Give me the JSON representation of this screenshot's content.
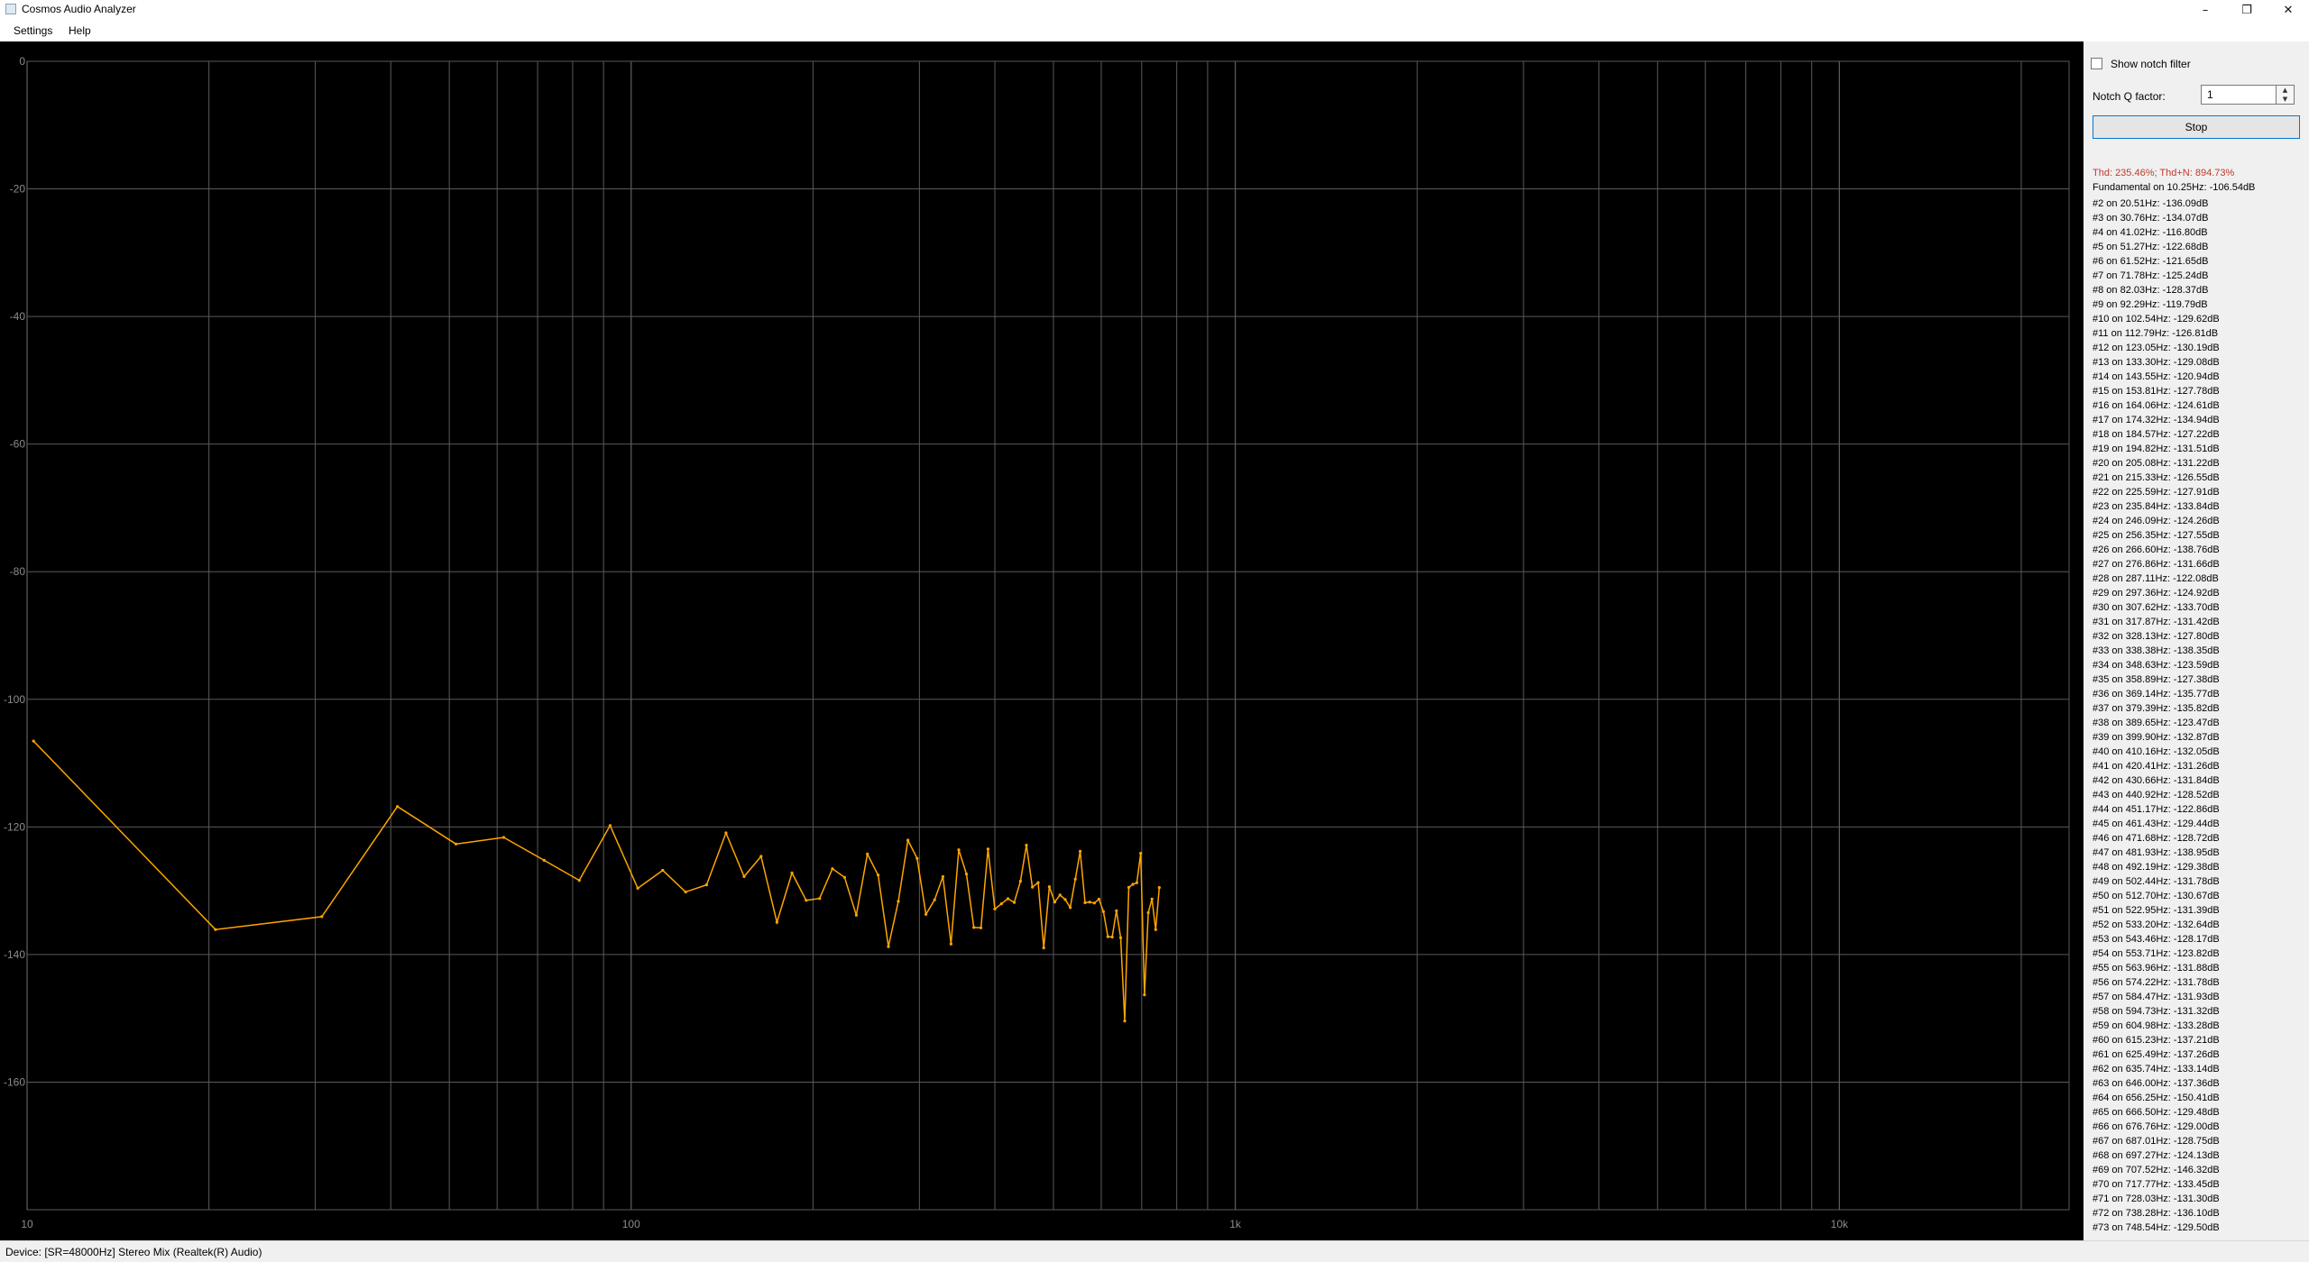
{
  "window": {
    "title": "Cosmos Audio Analyzer",
    "controls": {
      "minimize": "–",
      "maximize": "❐",
      "close": "✕"
    }
  },
  "menu": {
    "items": [
      "Settings",
      "Help"
    ]
  },
  "chart_data": {
    "type": "line",
    "x_scale": "log",
    "xlim": [
      10,
      24000
    ],
    "ylim": [
      -180,
      0
    ],
    "x_tick_labels": [
      {
        "value": 10,
        "label": "10"
      },
      {
        "value": 100,
        "label": "100"
      },
      {
        "value": 1000,
        "label": "1k"
      },
      {
        "value": 10000,
        "label": "10k"
      }
    ],
    "y_ticks": [
      0,
      -20,
      -40,
      -60,
      -80,
      -100,
      -120,
      -140,
      -160
    ],
    "grid": true,
    "line_color": "#ffa500",
    "background": "#000000",
    "grid_color": "#5a5a5a",
    "axis_label_color": "#8c8c8c",
    "x": [
      10.25,
      20.51,
      30.76,
      41.02,
      51.27,
      61.52,
      71.78,
      82.03,
      92.29,
      102.54,
      112.79,
      123.05,
      133.3,
      143.55,
      153.81,
      164.06,
      174.32,
      184.57,
      194.82,
      205.08,
      215.33,
      225.59,
      235.84,
      246.09,
      256.35,
      266.6,
      276.86,
      287.11,
      297.36,
      307.62,
      317.87,
      328.13,
      338.38,
      348.63,
      358.89,
      369.14,
      379.39,
      389.65,
      399.9,
      410.16,
      420.41,
      430.66,
      440.92,
      451.17,
      461.43,
      471.68,
      481.93,
      492.19,
      502.44,
      512.7,
      522.95,
      533.2,
      543.46,
      553.71,
      563.96,
      574.22,
      584.47,
      594.73,
      604.98,
      615.23,
      625.49,
      635.74,
      646.0,
      656.25,
      666.5,
      676.76,
      687.01,
      697.27,
      707.52,
      717.77,
      728.03,
      738.28,
      748.54
    ],
    "y": [
      -106.54,
      -136.09,
      -134.07,
      -116.8,
      -122.68,
      -121.65,
      -125.24,
      -128.37,
      -119.79,
      -129.62,
      -126.81,
      -130.19,
      -129.08,
      -120.94,
      -127.78,
      -124.61,
      -134.94,
      -127.22,
      -131.51,
      -131.22,
      -126.55,
      -127.91,
      -133.84,
      -124.26,
      -127.55,
      -138.76,
      -131.66,
      -122.08,
      -124.92,
      -133.7,
      -131.42,
      -127.8,
      -138.35,
      -123.59,
      -127.38,
      -135.77,
      -135.82,
      -123.47,
      -132.87,
      -132.05,
      -131.26,
      -131.84,
      -128.52,
      -122.86,
      -129.44,
      -128.72,
      -138.95,
      -129.38,
      -131.78,
      -130.67,
      -131.39,
      -132.64,
      -128.17,
      -123.82,
      -131.88,
      -131.78,
      -131.93,
      -131.32,
      -133.28,
      -137.21,
      -137.26,
      -133.14,
      -137.36,
      -150.41,
      -129.48,
      -129.0,
      -128.75,
      -124.13,
      -146.32,
      -133.45,
      -131.3,
      -136.1,
      -129.5
    ]
  },
  "controls": {
    "show_notch_label": "Show notch filter",
    "show_notch_checked": false,
    "notch_q_label": "Notch Q factor:",
    "notch_q_value": "1",
    "stop_label": "Stop"
  },
  "results": {
    "thd": "Thd: 235.46%; Thd+N: 894.73%",
    "fundamental": "Fundamental on 10.25Hz: -106.54dB",
    "harmonics": [
      "#2 on 20.51Hz: -136.09dB",
      "#3 on 30.76Hz: -134.07dB",
      "#4 on 41.02Hz: -116.80dB",
      "#5 on 51.27Hz: -122.68dB",
      "#6 on 61.52Hz: -121.65dB",
      "#7 on 71.78Hz: -125.24dB",
      "#8 on 82.03Hz: -128.37dB",
      "#9 on 92.29Hz: -119.79dB",
      "#10 on 102.54Hz: -129.62dB",
      "#11 on 112.79Hz: -126.81dB",
      "#12 on 123.05Hz: -130.19dB",
      "#13 on 133.30Hz: -129.08dB",
      "#14 on 143.55Hz: -120.94dB",
      "#15 on 153.81Hz: -127.78dB",
      "#16 on 164.06Hz: -124.61dB",
      "#17 on 174.32Hz: -134.94dB",
      "#18 on 184.57Hz: -127.22dB",
      "#19 on 194.82Hz: -131.51dB",
      "#20 on 205.08Hz: -131.22dB",
      "#21 on 215.33Hz: -126.55dB",
      "#22 on 225.59Hz: -127.91dB",
      "#23 on 235.84Hz: -133.84dB",
      "#24 on 246.09Hz: -124.26dB",
      "#25 on 256.35Hz: -127.55dB",
      "#26 on 266.60Hz: -138.76dB",
      "#27 on 276.86Hz: -131.66dB",
      "#28 on 287.11Hz: -122.08dB",
      "#29 on 297.36Hz: -124.92dB",
      "#30 on 307.62Hz: -133.70dB",
      "#31 on 317.87Hz: -131.42dB",
      "#32 on 328.13Hz: -127.80dB",
      "#33 on 338.38Hz: -138.35dB",
      "#34 on 348.63Hz: -123.59dB",
      "#35 on 358.89Hz: -127.38dB",
      "#36 on 369.14Hz: -135.77dB",
      "#37 on 379.39Hz: -135.82dB",
      "#38 on 389.65Hz: -123.47dB",
      "#39 on 399.90Hz: -132.87dB",
      "#40 on 410.16Hz: -132.05dB",
      "#41 on 420.41Hz: -131.26dB",
      "#42 on 430.66Hz: -131.84dB",
      "#43 on 440.92Hz: -128.52dB",
      "#44 on 451.17Hz: -122.86dB",
      "#45 on 461.43Hz: -129.44dB",
      "#46 on 471.68Hz: -128.72dB",
      "#47 on 481.93Hz: -138.95dB",
      "#48 on 492.19Hz: -129.38dB",
      "#49 on 502.44Hz: -131.78dB",
      "#50 on 512.70Hz: -130.67dB",
      "#51 on 522.95Hz: -131.39dB",
      "#52 on 533.20Hz: -132.64dB",
      "#53 on 543.46Hz: -128.17dB",
      "#54 on 553.71Hz: -123.82dB",
      "#55 on 563.96Hz: -131.88dB",
      "#56 on 574.22Hz: -131.78dB",
      "#57 on 584.47Hz: -131.93dB",
      "#58 on 594.73Hz: -131.32dB",
      "#59 on 604.98Hz: -133.28dB",
      "#60 on 615.23Hz: -137.21dB",
      "#61 on 625.49Hz: -137.26dB",
      "#62 on 635.74Hz: -133.14dB",
      "#63 on 646.00Hz: -137.36dB",
      "#64 on 656.25Hz: -150.41dB",
      "#65 on 666.50Hz: -129.48dB",
      "#66 on 676.76Hz: -129.00dB",
      "#67 on 687.01Hz: -128.75dB",
      "#68 on 697.27Hz: -124.13dB",
      "#69 on 707.52Hz: -146.32dB",
      "#70 on 717.77Hz: -133.45dB",
      "#71 on 728.03Hz: -131.30dB",
      "#72 on 738.28Hz: -136.10dB",
      "#73 on 748.54Hz: -129.50dB"
    ]
  },
  "status": {
    "device": "Device: [SR=48000Hz] Stereo Mix (Realtek(R) Audio)"
  }
}
